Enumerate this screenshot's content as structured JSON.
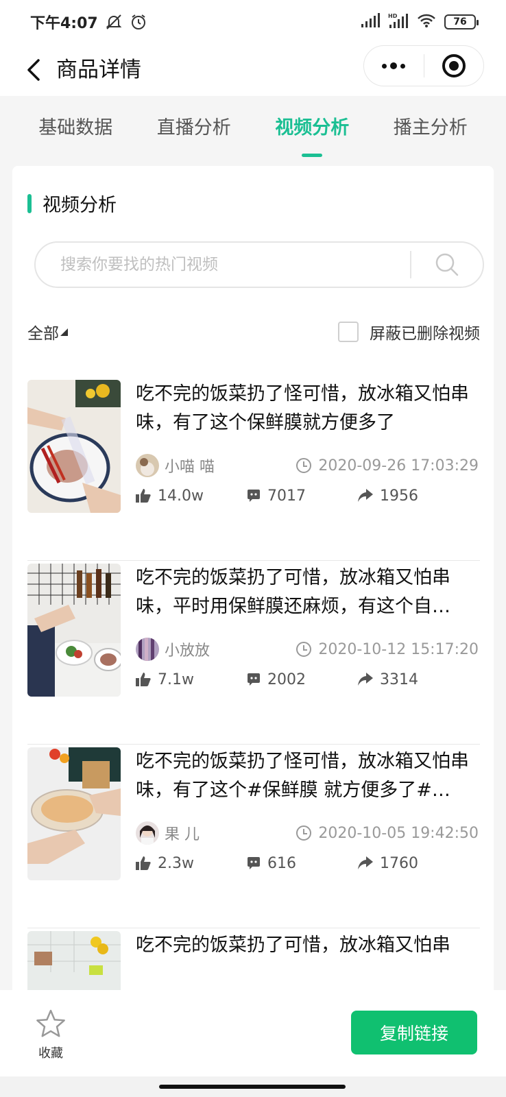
{
  "status_bar": {
    "time": "下午4:07",
    "battery": "76"
  },
  "nav": {
    "title": "商品详情"
  },
  "tabs": [
    {
      "label": "基础数据",
      "active": false
    },
    {
      "label": "直播分析",
      "active": false
    },
    {
      "label": "视频分析",
      "active": true
    },
    {
      "label": "播主分析",
      "active": false
    }
  ],
  "section": {
    "title": "视频分析"
  },
  "search": {
    "placeholder": "搜索你要找的热门视频",
    "value": ""
  },
  "filter": {
    "selected": "全部",
    "hide_deleted_label": "屏蔽已删除视频"
  },
  "videos": [
    {
      "title": "吃不完的饭菜扔了怪可惜，放冰箱又怕串味，有了这个保鲜膜就方便多了",
      "author": "小喵 喵",
      "time": "2020-09-26 17:03:29",
      "likes": "14.0w",
      "comments": "7017",
      "shares": "1956"
    },
    {
      "title": "吃不完的饭菜扔了可惜，放冰箱又怕串味，平时用保鲜膜还麻烦，有这个自…",
      "author": "小放放",
      "time": "2020-10-12 15:17:20",
      "likes": "7.1w",
      "comments": "2002",
      "shares": "3314"
    },
    {
      "title": "吃不完的饭菜扔了怪可惜，放冰箱又怕串味，有了这个#保鲜膜 就方便多了#…",
      "author": "果 儿",
      "time": "2020-10-05 19:42:50",
      "likes": "2.3w",
      "comments": "616",
      "shares": "1760"
    },
    {
      "title": "吃不完的饭菜扔了可惜，放冰箱又怕串",
      "author": "",
      "time": "",
      "likes": "",
      "comments": "",
      "shares": ""
    }
  ],
  "bottom": {
    "favorite_label": "收藏",
    "copy_link_label": "复制链接"
  },
  "colors": {
    "accent": "#1bbf93",
    "button_green": "#10c070"
  }
}
